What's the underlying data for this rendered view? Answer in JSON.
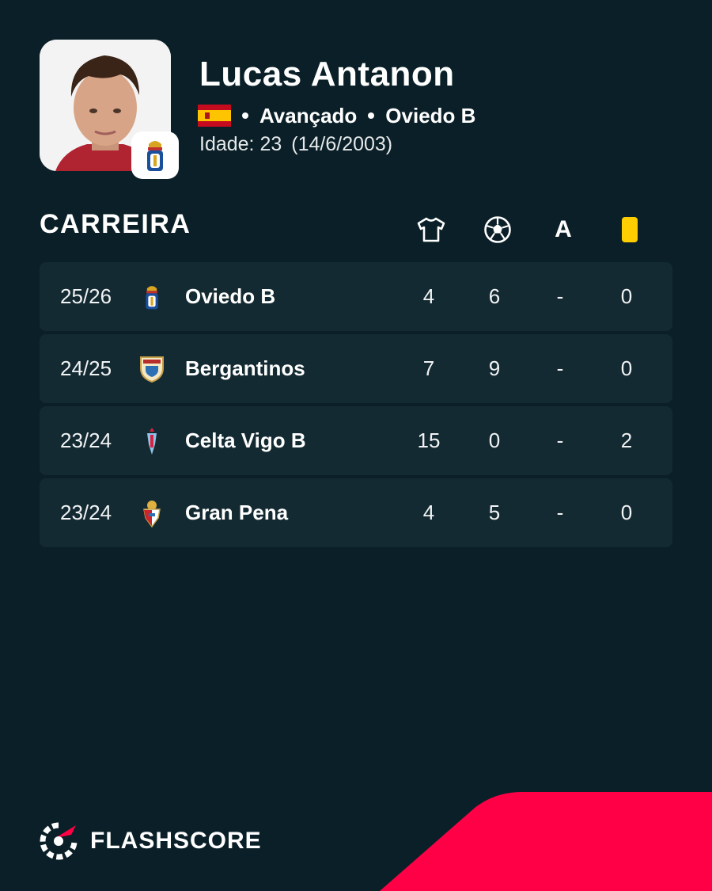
{
  "player": {
    "name": "Lucas Antanon",
    "position": "Avançado",
    "club": "Oviedo B",
    "age_label": "Idade: 23",
    "birth_date": "(14/6/2003)",
    "nationality_icon": "spain-flag-icon"
  },
  "career": {
    "title": "CARREIRA",
    "columns": [
      {
        "icon": "shirt-icon"
      },
      {
        "icon": "ball-icon"
      },
      {
        "label": "A"
      },
      {
        "icon": "yellow-card-icon"
      }
    ],
    "rows": [
      {
        "season": "25/26",
        "club": "Oviedo B",
        "appearances": "4",
        "goals": "6",
        "assists": "-",
        "yellow_cards": "0"
      },
      {
        "season": "24/25",
        "club": "Bergantinos",
        "appearances": "7",
        "goals": "9",
        "assists": "-",
        "yellow_cards": "0"
      },
      {
        "season": "23/24",
        "club": "Celta Vigo B",
        "appearances": "15",
        "goals": "0",
        "assists": "-",
        "yellow_cards": "2"
      },
      {
        "season": "23/24",
        "club": "Gran Pena",
        "appearances": "4",
        "goals": "5",
        "assists": "-",
        "yellow_cards": "0"
      }
    ]
  },
  "brand": {
    "name": "FLASHSCORE",
    "logo_icon": "flashscore-logo-icon"
  },
  "colors": {
    "background": "#0a1f27",
    "row": "#142a32",
    "accent": "#ff0046",
    "card": "#ffcd00"
  }
}
